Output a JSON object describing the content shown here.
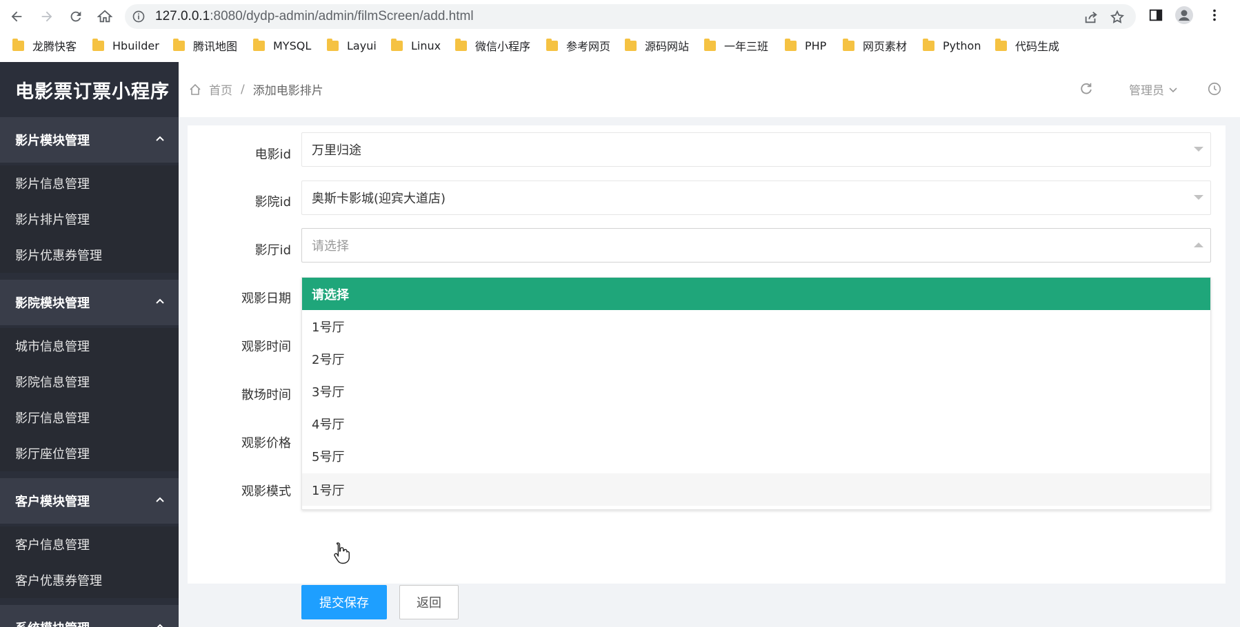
{
  "browser": {
    "url_host": "127.0.0.1",
    "url_rest": ":8080/dydp-admin/admin/filmScreen/add.html",
    "bookmarks": [
      "龙腾快客",
      "Hbuilder",
      "腾讯地图",
      "MYSQL",
      "Layui",
      "Linux",
      "微信小程序",
      "参考网页",
      "源码网站",
      "一年三班",
      "PHP",
      "网页素材",
      "Python",
      "代码生成"
    ]
  },
  "sidebar": {
    "logo": "电影票订票小程序",
    "groups": [
      {
        "title": "影片模块管理",
        "items": [
          "影片信息管理",
          "影片排片管理",
          "影片优惠券管理"
        ]
      },
      {
        "title": "影院模块管理",
        "items": [
          "城市信息管理",
          "影院信息管理",
          "影厅信息管理",
          "影厅座位管理"
        ]
      },
      {
        "title": "客户模块管理",
        "items": [
          "客户信息管理",
          "客户优惠券管理"
        ]
      },
      {
        "title": "系统模块管理",
        "items": []
      }
    ]
  },
  "header": {
    "home": "首页",
    "separator": "/",
    "current": "添加电影排片",
    "user": "管理员"
  },
  "form": {
    "fields": [
      {
        "label": "电影id",
        "value": "万里归途"
      },
      {
        "label": "影院id",
        "value": "奥斯卡影城(迎宾大道店)"
      },
      {
        "label": "影厅id",
        "placeholder": "请选择"
      },
      {
        "label": "观影日期"
      },
      {
        "label": "观影时间"
      },
      {
        "label": "散场时间"
      },
      {
        "label": "观影价格"
      },
      {
        "label": "观影模式"
      }
    ],
    "dropdown_options": [
      "请选择",
      "1号厅",
      "2号厅",
      "3号厅",
      "4号厅",
      "5号厅",
      "1号厅"
    ],
    "submit": "提交保存",
    "back": "返回"
  },
  "colors": {
    "sidebar_bg": "#2b2f3a",
    "group_bg": "#393d49",
    "selected_option": "#1fa67a",
    "primary_button": "#1e9fff"
  }
}
